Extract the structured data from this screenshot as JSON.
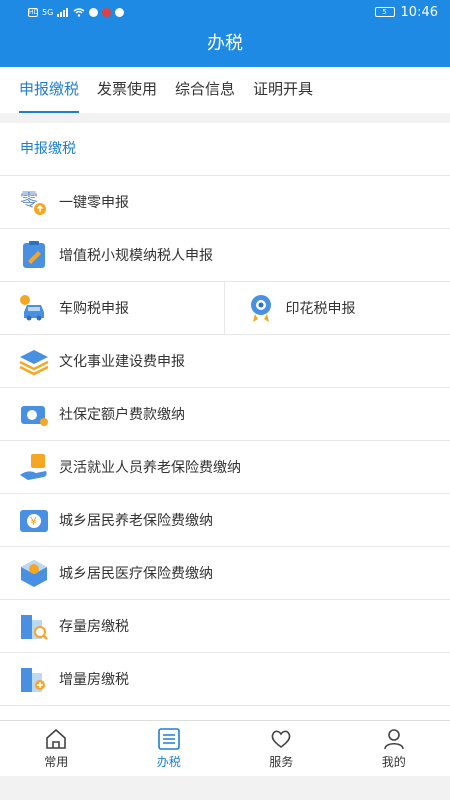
{
  "status": {
    "left": [
      "HD",
      "5G"
    ],
    "battery": "5",
    "time": "10:46"
  },
  "header": {
    "title": "办税"
  },
  "tabs": [
    "申报缴税",
    "发票使用",
    "综合信息",
    "证明开具"
  ],
  "section": {
    "title": "申报缴税"
  },
  "items": {
    "zero_declare": "一键零申报",
    "vat_small": "增值税小规模纳税人申报",
    "vehicle_tax": "车购税申报",
    "stamp_tax": "印花税申报",
    "culture_fee": "文化事业建设费申报",
    "social_fee": "社保定额户费款缴纳",
    "flexible_pension": "灵活就业人员养老保险费缴纳",
    "resident_pension": "城乡居民养老保险费缴纳",
    "resident_medical": "城乡居民医疗保险费缴纳",
    "stock_house": "存量房缴税",
    "new_house": "增量房缴税"
  },
  "icon_char": {
    "zero": "零",
    "yuan": "¥"
  },
  "nav": [
    "常用",
    "办税",
    "服务",
    "我的"
  ],
  "colors": {
    "primary": "#1e8ae3",
    "active": "#1e7fd2",
    "orange": "#f5a623"
  }
}
